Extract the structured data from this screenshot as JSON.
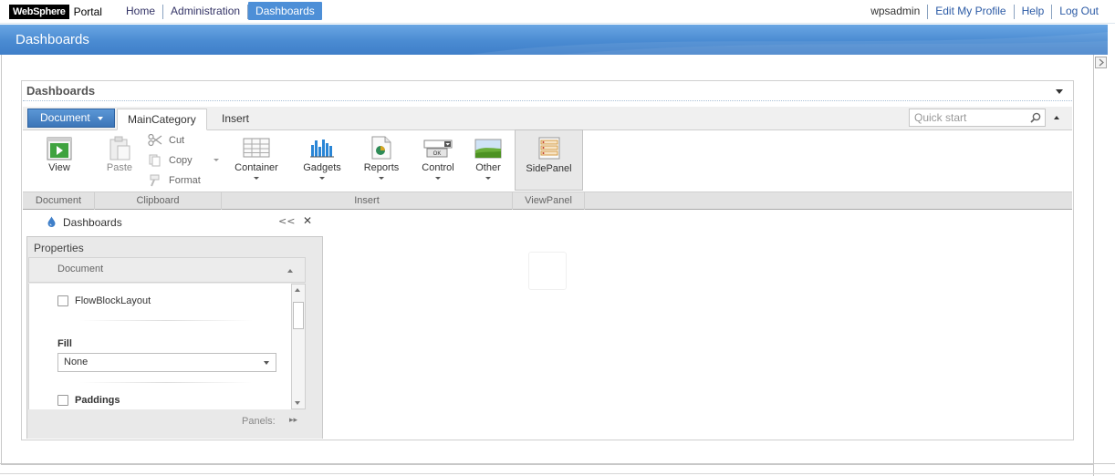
{
  "logo": {
    "brand": "WebSphere",
    "product": "Portal"
  },
  "nav": {
    "left": [
      {
        "label": "Home",
        "active": false
      },
      {
        "label": "Administration",
        "active": false
      },
      {
        "label": "Dashboards",
        "active": true
      }
    ],
    "right": {
      "user": "wpsadmin",
      "edit_profile": "Edit My Profile",
      "help": "Help",
      "logout": "Log Out"
    }
  },
  "banner": {
    "title": "Dashboards"
  },
  "portlet": {
    "title": "Dashboards",
    "ribbon": {
      "document_button": "Document",
      "tabs": [
        "MainCategory",
        "Insert"
      ],
      "active_tab": "MainCategory",
      "quick_start_placeholder": "Quick start",
      "buttons": {
        "view": "View",
        "paste": "Paste",
        "cut": "Cut",
        "copy": "Copy",
        "format": "Format",
        "container": "Container",
        "gadgets": "Gadgets",
        "reports": "Reports",
        "control": "Control",
        "other": "Other",
        "sidepanel": "SidePanel"
      },
      "groups": [
        "Document",
        "Clipboard",
        "Insert",
        "ViewPanel"
      ]
    },
    "side_panel": {
      "title": "Dashboards",
      "collapse": "<<",
      "close": "✕",
      "properties_label": "Properties",
      "section": "Document",
      "flow_block_layout": "FlowBlockLayout",
      "fill_label": "Fill",
      "fill_value": "None",
      "paddings": "Paddings",
      "panels_label": "Panels:",
      "panels_toggle": "▸▸"
    }
  },
  "colors": {
    "accent": "#4d8fd7",
    "banner": "#4a8bd2",
    "ribbon_group_bg": "#e2e2e2"
  }
}
